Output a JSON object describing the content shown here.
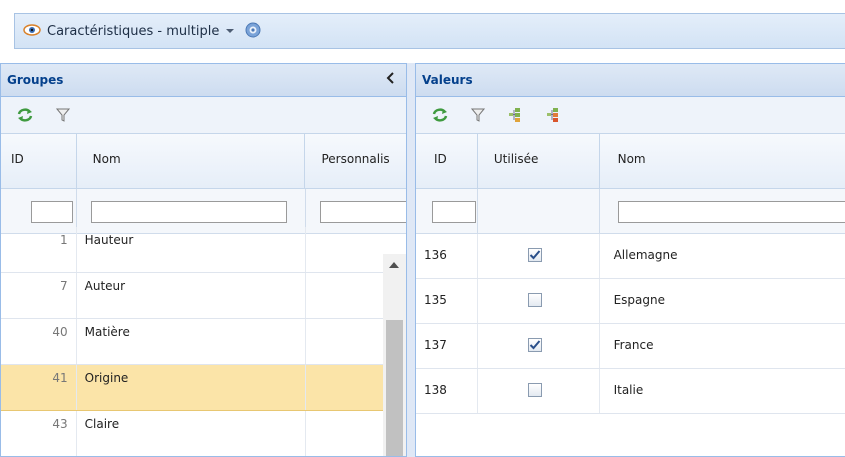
{
  "title": {
    "label": "Caractéristiques - multiple"
  },
  "groups": {
    "title": "Groupes",
    "columns": {
      "id": "ID",
      "name": "Nom",
      "custom": "Personnalis"
    },
    "rows": [
      {
        "id": "1",
        "name": "Hauteur",
        "selected": false
      },
      {
        "id": "7",
        "name": "Auteur",
        "selected": false
      },
      {
        "id": "40",
        "name": "Matière",
        "selected": false
      },
      {
        "id": "41",
        "name": "Origine",
        "selected": true
      },
      {
        "id": "43",
        "name": "Claire",
        "selected": false
      }
    ]
  },
  "values": {
    "title": "Valeurs",
    "columns": {
      "id": "ID",
      "used": "Utilisée",
      "name": "Nom"
    },
    "rows": [
      {
        "id": "136",
        "used": true,
        "name": "Allemagne"
      },
      {
        "id": "135",
        "used": false,
        "name": "Espagne"
      },
      {
        "id": "137",
        "used": true,
        "name": "France"
      },
      {
        "id": "138",
        "used": false,
        "name": "Italie"
      }
    ]
  },
  "icons": {
    "view": "eye-icon",
    "dropdown": "chevron-down-icon",
    "help": "help-icon",
    "refresh": "refresh-icon",
    "filter": "filter-icon",
    "add_value": "add-value-icon",
    "remove_value": "remove-value-icon",
    "collapse": "chevron-left-icon"
  },
  "colors": {
    "accent": "#04408c",
    "selection": "#fbe4a8",
    "border": "#99bce8"
  }
}
